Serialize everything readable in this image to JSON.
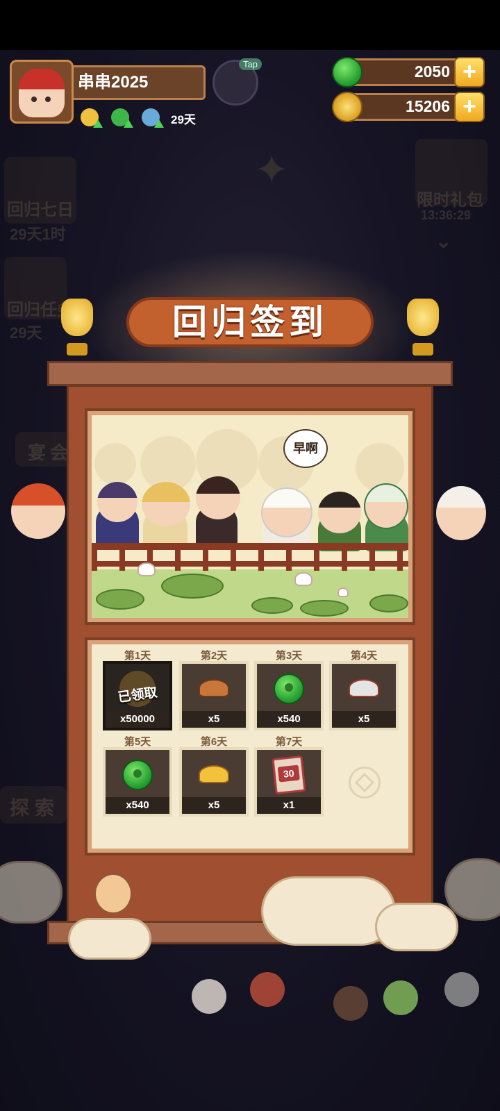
{
  "player": {
    "name": "串串2025",
    "return_days": "29天",
    "tap_label": "Tap"
  },
  "currency": {
    "jade": "2050",
    "coins": "15206"
  },
  "background": {
    "event1_title": "回归七日",
    "event1_timer": "29天1时",
    "event2_title": "回归任务",
    "event2_timer": "29天",
    "limited_gift_title": "限时礼包",
    "limited_gift_timer": "13:36:29",
    "side_btn_1": "宴会",
    "side_btn_2": "探索"
  },
  "popup": {
    "title": "回归签到",
    "speech_bubble": "早啊",
    "claimed_label": "已领取",
    "rewards": [
      {
        "day": "第1天",
        "count": "x50000",
        "item": "coin-icon",
        "claimed": true
      },
      {
        "day": "第2天",
        "count": "x5",
        "item": "bronze-ingot-icon",
        "claimed": false
      },
      {
        "day": "第3天",
        "count": "x540",
        "item": "jade-icon",
        "claimed": false
      },
      {
        "day": "第4天",
        "count": "x5",
        "item": "silver-ingot-icon",
        "claimed": false
      },
      {
        "day": "第5天",
        "count": "x540",
        "item": "jade-icon",
        "claimed": false
      },
      {
        "day": "第6天",
        "count": "x5",
        "item": "gold-ingot-icon",
        "claimed": false
      },
      {
        "day": "第7天",
        "count": "x1",
        "item": "ticket-icon",
        "ticket_number": "30",
        "claimed": false
      }
    ]
  },
  "colors": {
    "board": "#a14f31",
    "panel": "#f4ead0",
    "accent": "#c2602e"
  }
}
